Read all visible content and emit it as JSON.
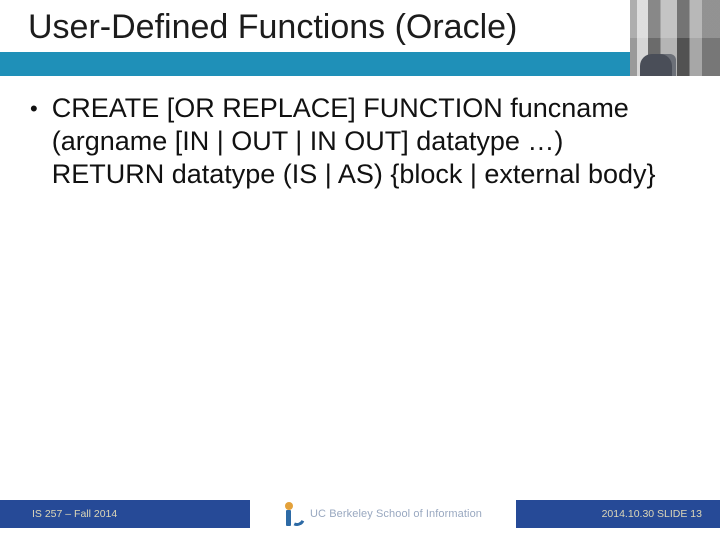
{
  "title": "User-Defined Functions (Oracle)",
  "bullets": [
    "CREATE [OR REPLACE] FUNCTION funcname (argname [IN | OUT | IN OUT] datatype …) RETURN datatype (IS | AS) {block | external body}"
  ],
  "footer": {
    "left": "IS 257 – Fall 2014",
    "center": "UC Berkeley School of Information",
    "right": "2014.10.30 SLIDE 13"
  },
  "colors": {
    "band": "#1f90b8",
    "footer_bg": "#264a97",
    "footer_text": "#ddd7b7"
  }
}
